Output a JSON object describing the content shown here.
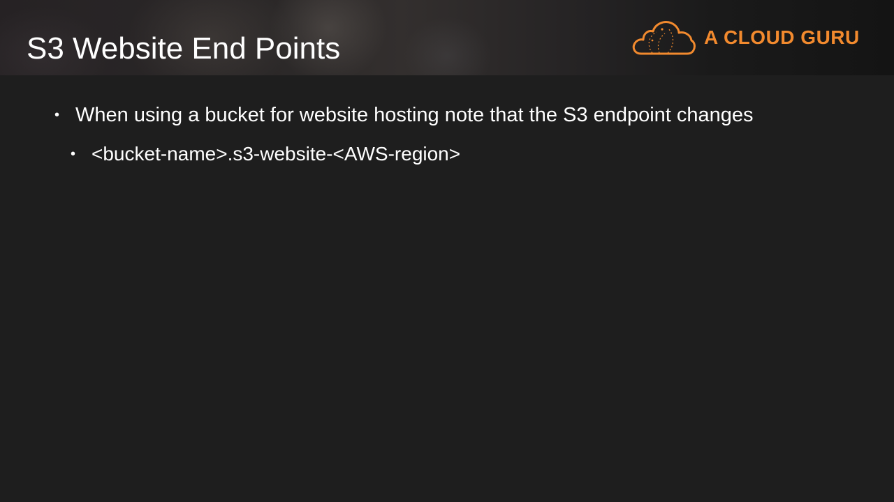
{
  "slide": {
    "title": "S3 Website End Points",
    "logo": {
      "text": "A CLOUD GURU",
      "icon": "cloud-icon",
      "color": "#f28a2e"
    },
    "bullets": [
      {
        "level": 1,
        "marker": "•",
        "text": "When using a bucket for website hosting note that the S3 endpoint changes"
      },
      {
        "level": 2,
        "marker": "•",
        "text": "<bucket-name>.s3-website-<AWS-region>"
      }
    ]
  }
}
